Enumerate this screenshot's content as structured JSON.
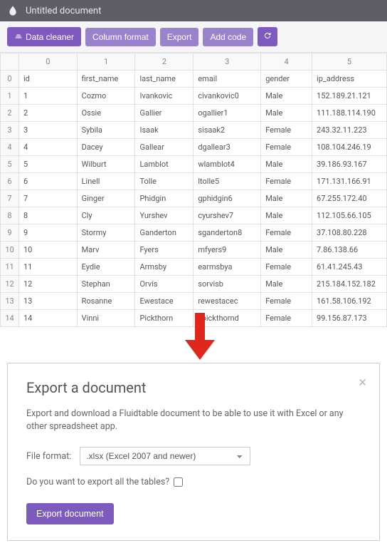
{
  "header": {
    "title": "Untitled document"
  },
  "toolbar": {
    "data_cleaner": "Data cleaner",
    "column_format": "Column format",
    "export": "Export",
    "add_code": "Add code"
  },
  "table": {
    "col_headers": [
      "",
      "0",
      "1",
      "2",
      "3",
      "4",
      "5"
    ],
    "rows": [
      {
        "rh": "0",
        "cells": [
          "id",
          "first_name",
          "last_name",
          "email",
          "gender",
          "ip_address"
        ]
      },
      {
        "rh": "1",
        "cells": [
          "1",
          "Cozmo",
          "Ivankovic",
          "civankovic0",
          "Male",
          "152.189.21.121"
        ]
      },
      {
        "rh": "2",
        "cells": [
          "2",
          "Ossie",
          "Gallier",
          "ogallier1",
          "Male",
          "111.188.114.190"
        ]
      },
      {
        "rh": "3",
        "cells": [
          "3",
          "Sybila",
          "Isaak",
          "sisaak2",
          "Female",
          "243.32.11.223"
        ]
      },
      {
        "rh": "4",
        "cells": [
          "4",
          "Dacey",
          "Gallear",
          "dgallear3",
          "Female",
          "108.104.246.19"
        ]
      },
      {
        "rh": "5",
        "cells": [
          "5",
          "Wilburt",
          "Lamblot",
          "wlamblot4",
          "Male",
          "39.186.93.167"
        ]
      },
      {
        "rh": "6",
        "cells": [
          "6",
          "Linell",
          "Tolle",
          "ltolle5",
          "Female",
          "171.131.166.91"
        ]
      },
      {
        "rh": "7",
        "cells": [
          "7",
          "Ginger",
          "Phidgin",
          "gphidgin6",
          "Male",
          "67.255.172.40"
        ]
      },
      {
        "rh": "8",
        "cells": [
          "8",
          "Cly",
          "Yurshev",
          "cyurshev7",
          "Male",
          "112.105.66.105"
        ]
      },
      {
        "rh": "9",
        "cells": [
          "9",
          "Stormy",
          "Ganderton",
          "sganderton8",
          "Female",
          "37.108.80.228"
        ]
      },
      {
        "rh": "10",
        "cells": [
          "10",
          "Marv",
          "Fyers",
          "mfyers9",
          "Male",
          "7.86.138.66"
        ]
      },
      {
        "rh": "11",
        "cells": [
          "11",
          "Eydie",
          "Armsby",
          "earmsbya",
          "Female",
          "61.41.245.43"
        ]
      },
      {
        "rh": "12",
        "cells": [
          "12",
          "Stephan",
          "Orvis",
          "sorvisb",
          "Male",
          "215.184.152.182"
        ]
      },
      {
        "rh": "13",
        "cells": [
          "13",
          "Rosanne",
          "Ewestace",
          "rewestacec",
          "Female",
          "161.58.106.192"
        ]
      },
      {
        "rh": "14",
        "cells": [
          "14",
          "Vinni",
          "Pickthorn",
          "vpickthornd",
          "Female",
          "99.156.87.173"
        ]
      }
    ]
  },
  "modal": {
    "title": "Export a document",
    "desc": "Export and download a Fluidtable document to be able to use it with Excel or any other spreadsheet app.",
    "file_format_label": "File format:",
    "file_format_value": ".xlsx (Excel 2007 and newer)",
    "checkbox_label": "Do you want to export all the tables?",
    "export_btn": "Export document"
  }
}
